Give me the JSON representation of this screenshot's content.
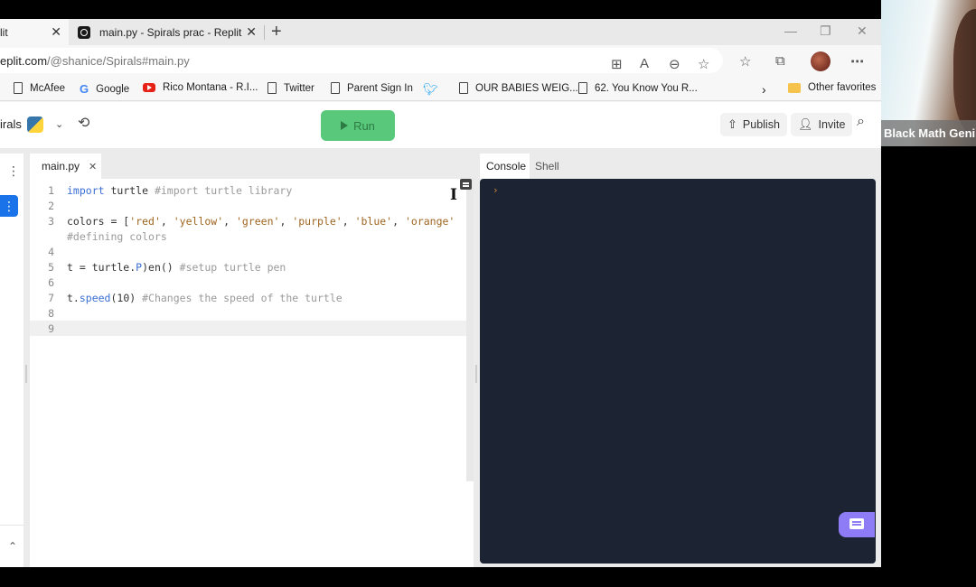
{
  "browser": {
    "tabs": [
      {
        "label": "lit",
        "active": false
      },
      {
        "label": "main.py - Spirals prac - Replit",
        "active": true
      }
    ],
    "new_tab_label": "+",
    "window_controls": {
      "minimize": "—",
      "restore": "❐",
      "close": "✕"
    },
    "url": {
      "host": "eplit.com",
      "path": "/@shanice/Spirals#main.py"
    },
    "toolbar_icons": [
      "apps-icon",
      "read-aloud-icon",
      "zoom-out-icon",
      "add-favorite-icon",
      "favorites-icon",
      "collections-icon",
      "profile-avatar",
      "more-icon"
    ],
    "bookmarks": [
      {
        "label": "McAfee",
        "icon": "page-icon"
      },
      {
        "label": "Google",
        "icon": "google-icon"
      },
      {
        "label": "Rico Montana - R.I...",
        "icon": "youtube-icon"
      },
      {
        "label": "Twitter",
        "icon": "page-icon"
      },
      {
        "label": "Parent Sign In",
        "icon": "page-icon"
      },
      {
        "label": "",
        "icon": "twitter-icon"
      },
      {
        "label": "OUR BABIES WEIG...",
        "icon": "page-icon"
      },
      {
        "label": "62. You Know You R...",
        "icon": "page-icon"
      }
    ],
    "bookmarks_overflow": "›",
    "other_favorites": "Other favorites"
  },
  "replit": {
    "repl_name": "irals",
    "run_label": "Run",
    "publish_label": "Publish",
    "invite_label": "Invite",
    "editor_tab": "main.py",
    "console_tabs": [
      "Console",
      "Shell"
    ],
    "console_prompt": "›",
    "colors": {
      "run": "#5ac87a",
      "console_bg": "#1c2333",
      "chat": "#8e7cf7",
      "sidebar_active": "#1a73e8"
    }
  },
  "code": {
    "lines": [
      {
        "n": "1",
        "tokens": [
          {
            "t": "import",
            "c": "kw"
          },
          {
            "t": " turtle ",
            "c": ""
          },
          {
            "t": "#import turtle library",
            "c": "cm"
          }
        ]
      },
      {
        "n": "2",
        "tokens": []
      },
      {
        "n": "3",
        "tokens": [
          {
            "t": "colors = [",
            "c": ""
          },
          {
            "t": "'red'",
            "c": "str"
          },
          {
            "t": ", ",
            "c": ""
          },
          {
            "t": "'yellow'",
            "c": "str"
          },
          {
            "t": ", ",
            "c": ""
          },
          {
            "t": "'green'",
            "c": "str"
          },
          {
            "t": ", ",
            "c": ""
          },
          {
            "t": "'purple'",
            "c": "str"
          },
          {
            "t": ", ",
            "c": ""
          },
          {
            "t": "'blue'",
            "c": "str"
          },
          {
            "t": ", ",
            "c": ""
          },
          {
            "t": "'orange'",
            "c": "str"
          }
        ]
      },
      {
        "n": "",
        "tokens": [
          {
            "t": "#defining colors",
            "c": "cm"
          }
        ]
      },
      {
        "n": "4",
        "tokens": []
      },
      {
        "n": "5",
        "tokens": [
          {
            "t": "t = turtle.",
            "c": ""
          },
          {
            "t": "P",
            "c": "fn"
          },
          {
            "t": ")en() ",
            "c": ""
          },
          {
            "t": "#setup turtle pen",
            "c": "cm"
          }
        ]
      },
      {
        "n": "6",
        "tokens": []
      },
      {
        "n": "7",
        "tokens": [
          {
            "t": "t.",
            "c": ""
          },
          {
            "t": "speed",
            "c": "fn"
          },
          {
            "t": "(10) ",
            "c": ""
          },
          {
            "t": "#Changes the speed of the turtle",
            "c": "cm"
          }
        ]
      },
      {
        "n": "8",
        "tokens": []
      },
      {
        "n": "9",
        "tokens": [],
        "current": true
      }
    ]
  },
  "webcam": {
    "label": "Black Math Geni"
  }
}
